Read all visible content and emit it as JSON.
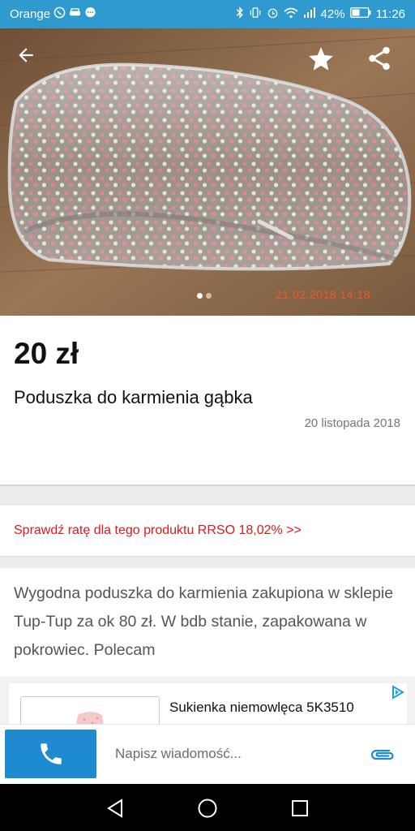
{
  "statusbar": {
    "carrier": "Orange",
    "battery": "42%",
    "time": "11:26"
  },
  "listing": {
    "image_count": 2,
    "active_image_index": 0,
    "photo_datestamp": "21.02.2018 14:18",
    "price": "20 zł",
    "title": "Poduszka do karmienia gąbka",
    "date": "20 listopada 2018",
    "installment_link": "Sprawdź ratę dla tego produktu RRSO 18,02% >>",
    "description": "Wygodna poduszka do karmienia zakupiona w sklepie Tup-Tup za ok 80 zł. W bdb stanie, zapakowana w pokrowiec. Polecam"
  },
  "ad": {
    "title": "Sukienka niemowlęca 5K3510"
  },
  "message": {
    "placeholder": "Napisz wiadomość..."
  },
  "colors": {
    "statusbar": "#2e9ad0",
    "call_button": "#1e8bd1",
    "installment_link": "#e0181c",
    "attach_icon": "#1e8bd1"
  },
  "icons": {
    "back": "arrow-left-icon",
    "favorite": "star-icon",
    "share": "share-icon",
    "call": "phone-icon",
    "attach": "paperclip-icon",
    "ad_choices": "ad-choices-icon",
    "nav_back": "triangle-back-icon",
    "nav_home": "circle-home-icon",
    "nav_recent": "square-recent-icon"
  }
}
